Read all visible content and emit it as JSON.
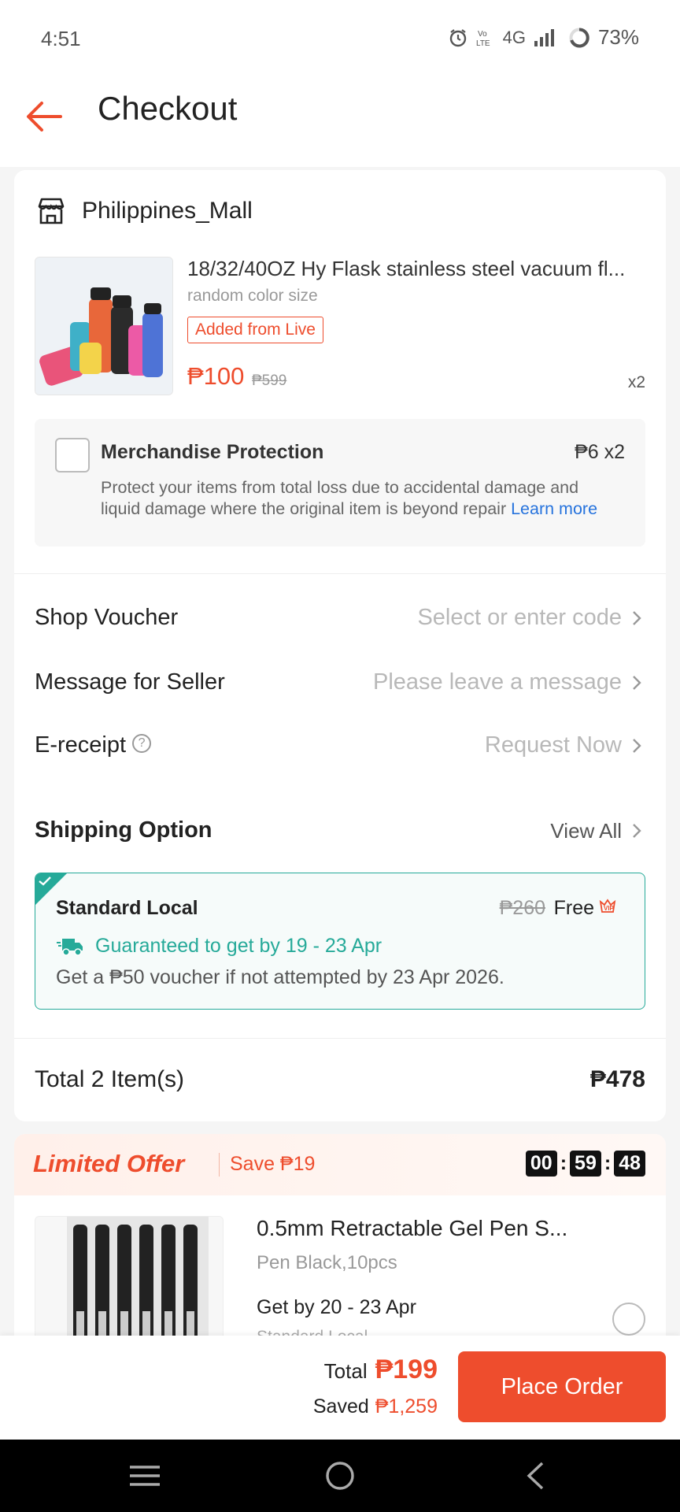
{
  "status_bar": {
    "time": "4:51",
    "network": "4G",
    "battery": "73%"
  },
  "header": {
    "title": "Checkout"
  },
  "shop": {
    "name": "Philippines_Mall"
  },
  "product": {
    "title": "18/32/40OZ Hy Flask stainless steel vacuum fl...",
    "variant": "random color size",
    "tag": "Added from Live",
    "price": "₱100",
    "original_price": "₱599",
    "quantity": "x2"
  },
  "protection": {
    "title": "Merchandise Protection",
    "price": "₱6 x2",
    "description": "Protect your items from total loss due to accidental damage and liquid damage where the original item is beyond repair ",
    "link": "Learn more"
  },
  "rows": {
    "voucher": {
      "label": "Shop Voucher",
      "value": "Select or enter code"
    },
    "message": {
      "label": "Message for Seller",
      "value": "Please leave a message"
    },
    "receipt": {
      "label": "E-receipt",
      "value": "Request Now"
    }
  },
  "shipping": {
    "title": "Shipping Option",
    "view_all": "View All",
    "option_name": "Standard Local",
    "original_fee": "₱260",
    "fee": "Free",
    "guarantee": "Guaranteed to get by 19 - 23 Apr",
    "voucher_note": "Get a ₱50 voucher if not attempted by 23 Apr 2026."
  },
  "order_total": {
    "label": "Total 2 Item(s)",
    "value": "₱478"
  },
  "limited_offer": {
    "title": "Limited Offer",
    "save": "Save ₱19",
    "timer": {
      "h": "00",
      "m": "59",
      "s": "48"
    },
    "product_title": "0.5mm Retractable Gel Pen S...",
    "variant": "Pen Black,10pcs",
    "get_by": "Get by 20 - 23 Apr",
    "method": "Standard Local"
  },
  "bottom": {
    "total_label": "Total",
    "total_value": "₱199",
    "saved_label": "Saved",
    "saved_value": "₱1,259",
    "place_order": "Place Order"
  },
  "colors": {
    "accent": "#ee4d2d",
    "teal": "#26aa99",
    "link": "#2673dd"
  },
  "icons": [
    "alarm-icon",
    "volte-icon",
    "signal-icon",
    "battery-icon",
    "back-arrow-icon",
    "store-icon",
    "chevron-right-icon",
    "info-icon",
    "check-icon",
    "truck-icon",
    "vip-icon",
    "menu-icon",
    "home-icon",
    "nav-back-icon"
  ]
}
